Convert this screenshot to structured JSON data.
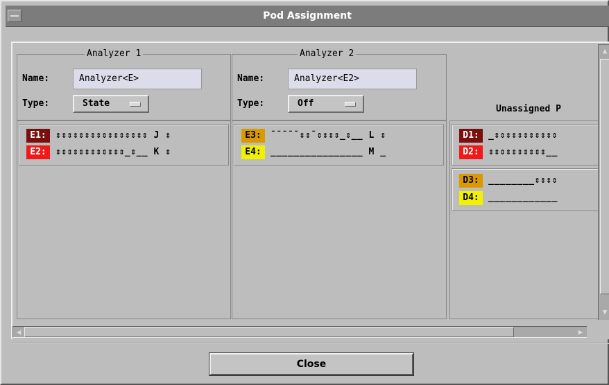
{
  "window": {
    "title": "Pod Assignment"
  },
  "analyzer1": {
    "legend": "Analyzer 1",
    "name_label": "Name:",
    "name_value": "Analyzer<E>",
    "type_label": "Type:",
    "type_value": "State",
    "pods": [
      {
        "tag": "E1:",
        "bits": "⇕⇕⇕⇕⇕⇕⇕⇕⇕⇕⇕⇕⇕⇕⇕⇕ J ⇕",
        "color": "#7a0f0f",
        "text_color": "#ffffff"
      },
      {
        "tag": "E2:",
        "bits": "⇕⇕⇕⇕⇕⇕⇕⇕⇕⇕⇕⇕_⇕__ K ⇕",
        "color": "#ee1a1a",
        "text_color": "#ffffff"
      }
    ]
  },
  "analyzer2": {
    "legend": "Analyzer 2",
    "name_label": "Name:",
    "name_value": "Analyzer<E2>",
    "type_label": "Type:",
    "type_value": "Off",
    "pods": [
      {
        "tag": "E3:",
        "bits": "¯¯¯¯¯⇕⇕¯⇕⇕⇕⇕_⇕__ L ⇕",
        "color": "#d99a00",
        "text_color": "#000000"
      },
      {
        "tag": "E4:",
        "bits": "________________ M _",
        "color": "#f2f200",
        "text_color": "#000000"
      }
    ]
  },
  "unassigned": {
    "heading": "Unassigned P",
    "pods": [
      {
        "tag": "D1:",
        "bits": "_⇕⇕⇕⇕⇕⇕⇕⇕⇕⇕⇕",
        "color": "#7a0f0f",
        "text_color": "#ffffff"
      },
      {
        "tag": "D2:",
        "bits": "⇕⇕⇕⇕⇕⇕⇕⇕⇕⇕__",
        "color": "#ee1a1a",
        "text_color": "#ffffff"
      },
      {
        "tag": "D3:",
        "bits": "________⇕⇕⇕⇕",
        "color": "#d99a00",
        "text_color": "#000000"
      },
      {
        "tag": "D4:",
        "bits": "____________",
        "color": "#f2f200",
        "text_color": "#000000"
      }
    ]
  },
  "footer": {
    "close_label": "Close"
  }
}
